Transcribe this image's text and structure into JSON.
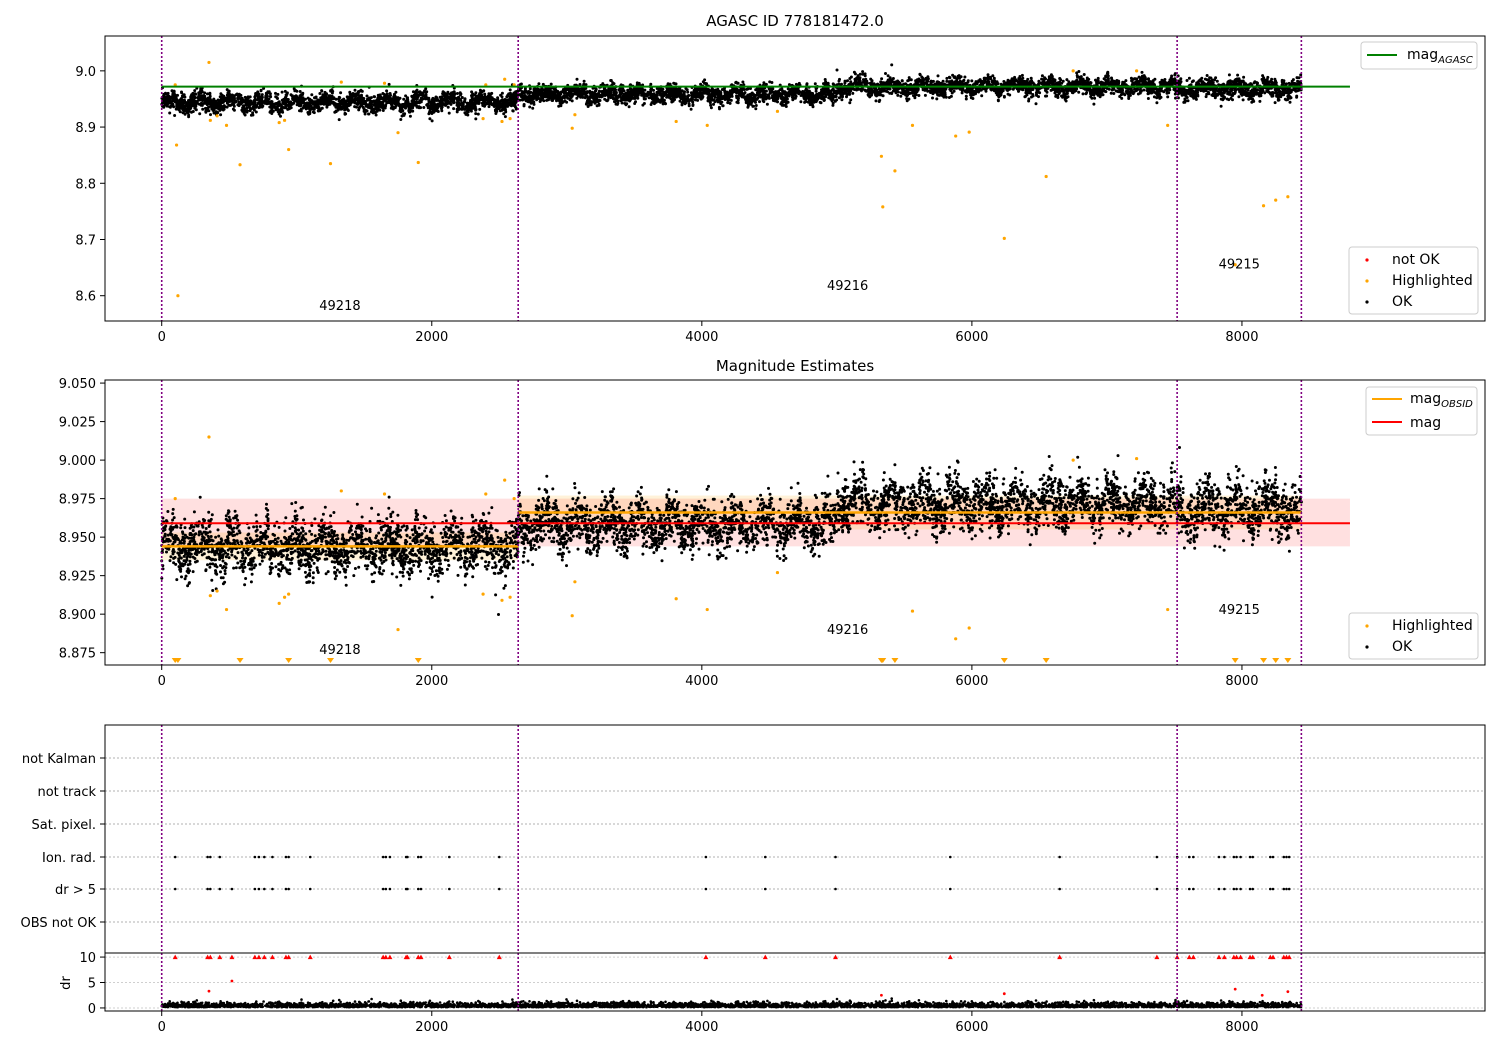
{
  "chart_data": [
    {
      "type": "scatter",
      "title": "AGASC ID 778181472.0",
      "xlim": [
        -420,
        9800
      ],
      "ylim": [
        8.555,
        9.062
      ],
      "xticks": [
        0,
        2000,
        4000,
        6000,
        8000
      ],
      "yticks": [
        8.6,
        8.7,
        8.8,
        8.9,
        9.0
      ],
      "ytick_labels": [
        "8.6",
        "8.7",
        "8.8",
        "8.9",
        "9.0"
      ],
      "obs_boundaries": [
        0,
        2640,
        7520,
        8440
      ],
      "obs_labels": [
        {
          "x": 1320,
          "y": 8.575,
          "text": "49218"
        },
        {
          "x": 5080,
          "y": 8.61,
          "text": "49216"
        },
        {
          "x": 7980,
          "y": 8.648,
          "text": "49215"
        }
      ],
      "reference_line": {
        "name": "mag_AGASC",
        "value": 8.972,
        "x_range": [
          0,
          8800
        ],
        "color": "#008000"
      },
      "ok_band_segments": [
        {
          "x0": 0,
          "x1": 2640,
          "mean": 8.944,
          "spread": 0.02
        },
        {
          "x0": 2640,
          "x1": 5000,
          "mean": 8.958,
          "spread": 0.018
        },
        {
          "x0": 5000,
          "x1": 7520,
          "mean": 8.972,
          "spread": 0.018
        },
        {
          "x0": 7520,
          "x1": 8440,
          "mean": 8.968,
          "spread": 0.02
        }
      ],
      "highlighted_points": [
        [
          100,
          8.975
        ],
        [
          110,
          8.868
        ],
        [
          120,
          8.6
        ],
        [
          350,
          9.015
        ],
        [
          360,
          8.912
        ],
        [
          410,
          8.92
        ],
        [
          480,
          8.903
        ],
        [
          580,
          8.833
        ],
        [
          870,
          8.908
        ],
        [
          910,
          8.912
        ],
        [
          940,
          8.86
        ],
        [
          1250,
          8.835
        ],
        [
          1330,
          8.98
        ],
        [
          1650,
          8.978
        ],
        [
          1750,
          8.89
        ],
        [
          1900,
          8.837
        ],
        [
          2380,
          8.915
        ],
        [
          2400,
          8.975
        ],
        [
          2520,
          8.91
        ],
        [
          2540,
          8.985
        ],
        [
          2580,
          8.915
        ],
        [
          2610,
          8.975
        ],
        [
          3040,
          8.898
        ],
        [
          3060,
          8.922
        ],
        [
          3810,
          8.91
        ],
        [
          4040,
          8.903
        ],
        [
          4560,
          8.928
        ],
        [
          5330,
          8.848
        ],
        [
          5340,
          8.758
        ],
        [
          5430,
          8.822
        ],
        [
          5560,
          8.903
        ],
        [
          5880,
          8.884
        ],
        [
          5980,
          8.891
        ],
        [
          6240,
          8.702
        ],
        [
          6550,
          8.812
        ],
        [
          6750,
          9.0
        ],
        [
          7220,
          9.0
        ],
        [
          7450,
          8.903
        ],
        [
          7950,
          8.655
        ],
        [
          8160,
          8.76
        ],
        [
          8250,
          8.77
        ],
        [
          8340,
          8.776
        ]
      ],
      "legend_lines": [
        {
          "label": "mag",
          "sub": "AGASC",
          "color": "#008000"
        }
      ],
      "legend_markers": [
        {
          "label": "not OK",
          "color": "#ff0000"
        },
        {
          "label": "Highlighted",
          "color": "#ffa500"
        },
        {
          "label": "OK",
          "color": "#000000"
        }
      ]
    },
    {
      "type": "scatter",
      "title": "Magnitude Estimates",
      "xlim": [
        -420,
        9800
      ],
      "ylim": [
        8.867,
        9.052
      ],
      "xticks": [
        0,
        2000,
        4000,
        6000,
        8000
      ],
      "yticks": [
        8.875,
        8.9,
        8.925,
        8.95,
        8.975,
        9.0,
        9.025,
        9.05
      ],
      "ytick_labels": [
        "8.875",
        "8.900",
        "8.925",
        "8.950",
        "8.975",
        "9.000",
        "9.025",
        "9.050"
      ],
      "obs_boundaries": [
        0,
        2640,
        7520,
        8440
      ],
      "obs_labels": [
        {
          "x": 1320,
          "y": 8.874,
          "text": "49218"
        },
        {
          "x": 5080,
          "y": 8.887,
          "text": "49216"
        },
        {
          "x": 7980,
          "y": 8.9,
          "text": "49215"
        }
      ],
      "mag": {
        "name": "mag",
        "value": 8.959,
        "band": [
          8.944,
          8.975
        ],
        "x_range": [
          0,
          8800
        ],
        "color": "#ff0000"
      },
      "mag_obsid": [
        {
          "name": "mag_OBSID",
          "x0": 0,
          "x1": 2640,
          "value": 8.944,
          "band": [
            8.935,
            8.953
          ]
        },
        {
          "name": "mag_OBSID",
          "x0": 2640,
          "x1": 8440,
          "value": 8.966,
          "band": [
            8.955,
            8.977
          ]
        }
      ],
      "ok_band_segments": [
        {
          "x0": 0,
          "x1": 2640,
          "mean": 8.944,
          "spread": 0.02
        },
        {
          "x0": 2640,
          "x1": 5000,
          "mean": 8.958,
          "spread": 0.018
        },
        {
          "x0": 5000,
          "x1": 7520,
          "mean": 8.972,
          "spread": 0.018
        },
        {
          "x0": 7520,
          "x1": 8440,
          "mean": 8.968,
          "spread": 0.02
        }
      ],
      "highlighted_points": [
        [
          100,
          8.975
        ],
        [
          350,
          9.015
        ],
        [
          360,
          8.912
        ],
        [
          410,
          8.915
        ],
        [
          480,
          8.903
        ],
        [
          870,
          8.907
        ],
        [
          910,
          8.911
        ],
        [
          940,
          8.913
        ],
        [
          1330,
          8.98
        ],
        [
          1650,
          8.978
        ],
        [
          1750,
          8.89
        ],
        [
          2380,
          8.913
        ],
        [
          2400,
          8.978
        ],
        [
          2520,
          8.909
        ],
        [
          2540,
          8.987
        ],
        [
          2580,
          8.911
        ],
        [
          2610,
          8.975
        ],
        [
          3040,
          8.899
        ],
        [
          3060,
          8.921
        ],
        [
          3810,
          8.91
        ],
        [
          4040,
          8.903
        ],
        [
          4560,
          8.927
        ],
        [
          5560,
          8.902
        ],
        [
          5880,
          8.884
        ],
        [
          5980,
          8.891
        ],
        [
          6750,
          9.0
        ],
        [
          7220,
          9.001
        ],
        [
          7450,
          8.903
        ]
      ],
      "offscale_markers_x": [
        100,
        120,
        580,
        940,
        1250,
        1900,
        5330,
        5340,
        5430,
        6240,
        6550,
        7950,
        8160,
        8250,
        8340
      ],
      "legend_lines": [
        {
          "label": "mag",
          "sub": "OBSID",
          "color": "#ffa500"
        },
        {
          "label": "mag",
          "sub": "",
          "color": "#ff0000"
        }
      ],
      "legend_markers": [
        {
          "label": "Highlighted",
          "color": "#ffa500"
        },
        {
          "label": "OK",
          "color": "#000000"
        }
      ]
    },
    {
      "type": "scatter",
      "xlim": [
        -420,
        9800
      ],
      "xticks": [
        0,
        2000,
        4000,
        6000,
        8000
      ],
      "obs_boundaries": [
        0,
        2640,
        7520,
        8440
      ],
      "flag_rows": [
        "not Kalman",
        "not track",
        "Sat. pixel.",
        "Ion. rad.",
        "dr > 5",
        "OBS not OK"
      ],
      "flag_events": {
        "Ion. rad.": [
          100,
          340,
          360,
          430,
          690,
          720,
          760,
          820,
          920,
          940,
          1100,
          1640,
          1660,
          1690,
          1810,
          1820,
          1900,
          1920,
          2130,
          2500,
          4030,
          4470,
          4990,
          5840,
          6650,
          7370,
          7520,
          7610,
          7640,
          7830,
          7870,
          7940,
          7960,
          7990,
          8060,
          8080,
          8210,
          8230,
          8310,
          8330,
          8350
        ],
        "dr > 5": [
          100,
          340,
          360,
          430,
          520,
          690,
          720,
          760,
          820,
          920,
          940,
          1100,
          1640,
          1660,
          1690,
          1810,
          1820,
          1900,
          1920,
          2130,
          2500,
          4030,
          4470,
          4990,
          5840,
          6650,
          7370,
          7520,
          7610,
          7640,
          7830,
          7870,
          7940,
          7960,
          7990,
          8060,
          8080,
          8210,
          8230,
          8310,
          8330,
          8350
        ]
      },
      "dr": {
        "ylabel": "dr",
        "ylim": [
          -0.6,
          10.8
        ],
        "yticks": [
          0,
          5,
          10
        ],
        "ytick_labels": [
          "0",
          "5",
          "10"
        ],
        "clipped_at": 10,
        "outliers": [
          [
            350,
            3.3
          ],
          [
            520,
            5.3
          ],
          [
            5330,
            2.5
          ],
          [
            6240,
            2.8
          ],
          [
            7950,
            3.7
          ],
          [
            8150,
            2.5
          ],
          [
            8340,
            3.2
          ]
        ]
      }
    }
  ],
  "colors": {
    "ok": "#000000",
    "highlighted": "#ffa500",
    "not_ok": "#ff0000",
    "agasc": "#008000",
    "mag": "#ff0000",
    "mag_obsid": "#ffa500",
    "boundary": "#800080"
  }
}
